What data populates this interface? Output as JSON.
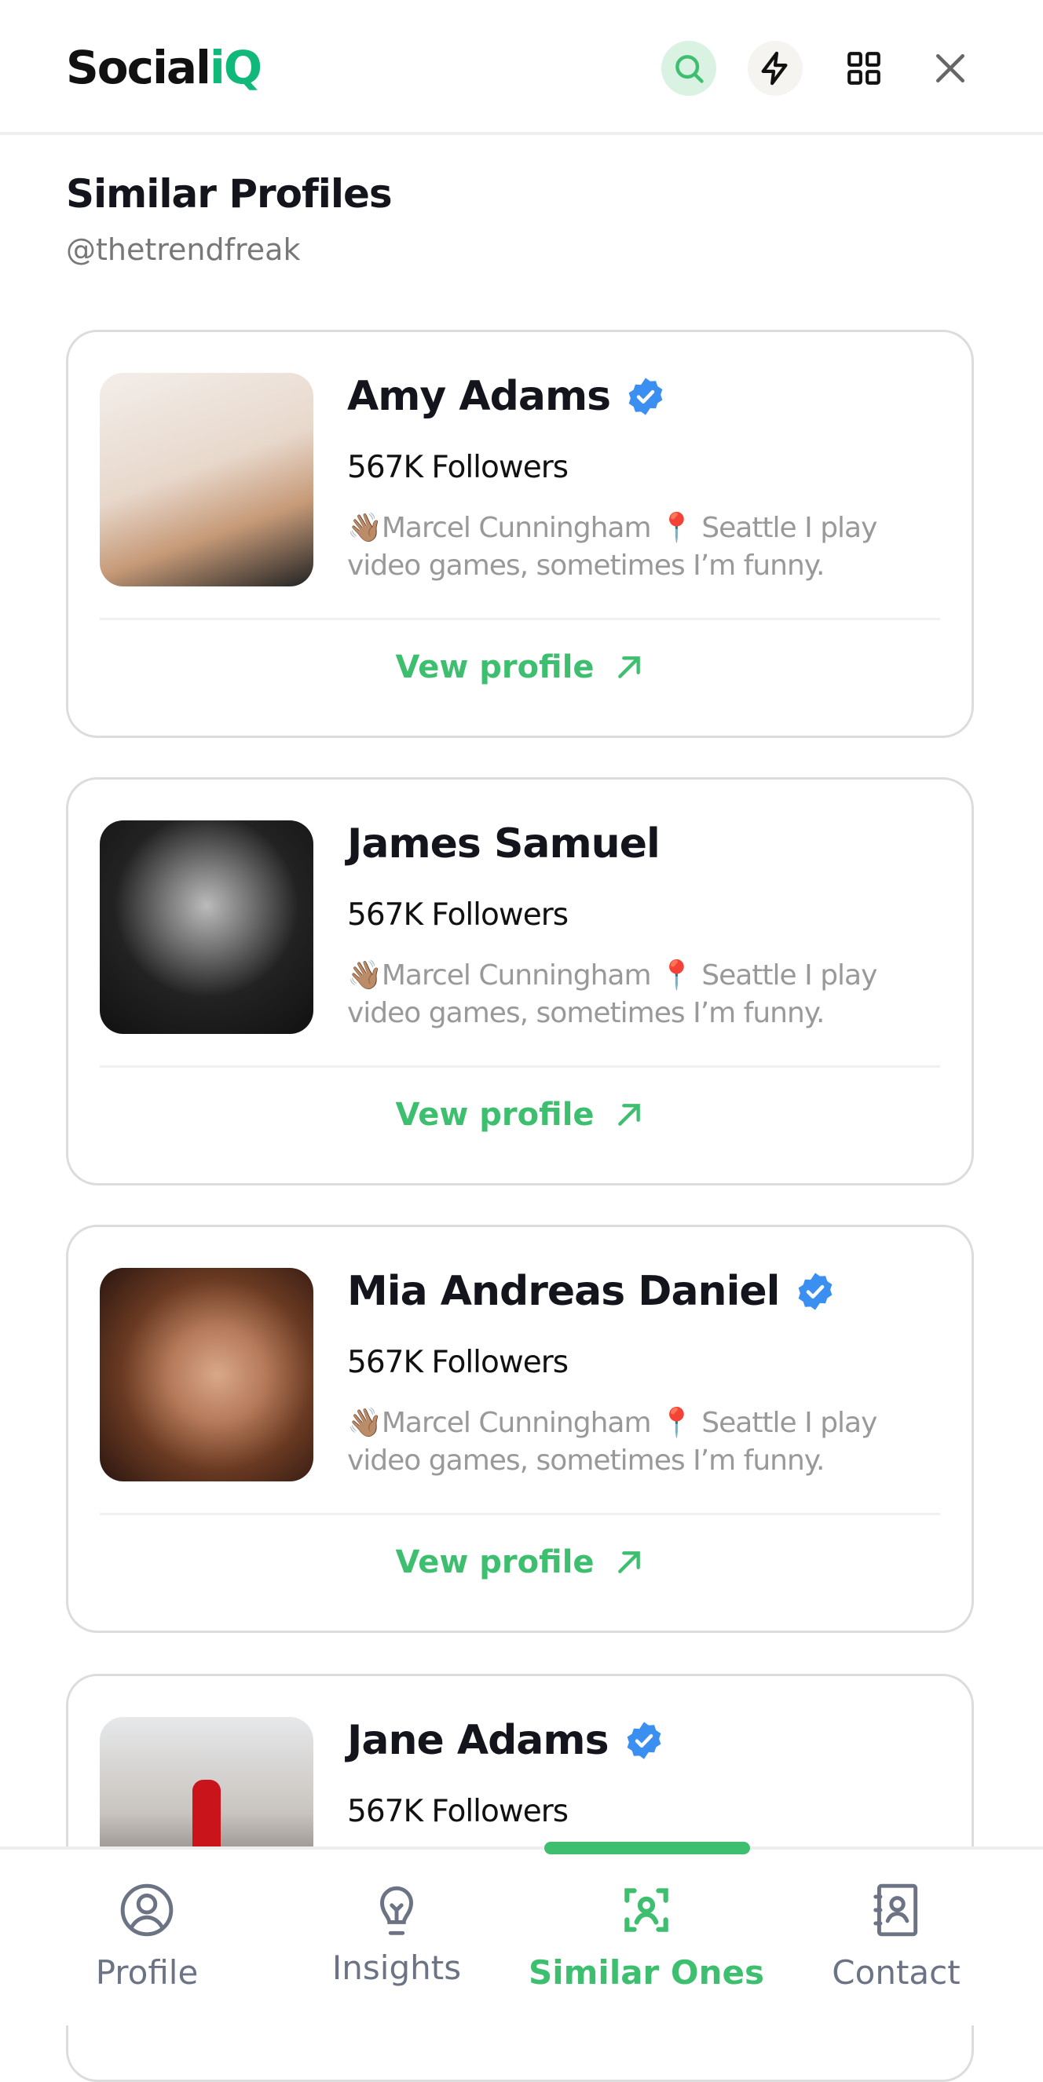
{
  "app": {
    "logo_main": "Social",
    "logo_accent": "iQ",
    "accent_color": "#3dbf6f"
  },
  "header": {
    "icons": [
      "search-icon",
      "bolt-icon",
      "grid-icon",
      "close-icon"
    ]
  },
  "page": {
    "title": "Similar Profiles",
    "handle": "@thetrendfreak"
  },
  "profiles": [
    {
      "name": "Amy Adams",
      "verified": true,
      "followers": "567K  Followers",
      "bio_line1": "👋🏽Marcel Cunningham 📍 Seattle I play",
      "bio_line2": "video games, sometimes I’m funny.",
      "action": "Vew profile"
    },
    {
      "name": "James Samuel",
      "verified": false,
      "followers": "567K  Followers",
      "bio_line1": "👋🏽Marcel Cunningham 📍 Seattle I play",
      "bio_line2": "video games, sometimes I’m funny.",
      "action": "Vew profile"
    },
    {
      "name": "Mia Andreas Daniel",
      "verified": true,
      "followers": "567K  Followers",
      "bio_line1": "👋🏽Marcel Cunningham 📍 Seattle I play",
      "bio_line2": "video games, sometimes I’m funny.",
      "action": "Vew profile"
    },
    {
      "name": "Jane Adams",
      "verified": true,
      "followers": "567K  Followers"
    }
  ],
  "nav": [
    {
      "label": "Profile",
      "icon": "user-circle-icon",
      "active": false
    },
    {
      "label": "Insights",
      "icon": "lightbulb-icon",
      "active": false
    },
    {
      "label": "Similar Ones",
      "icon": "user-scan-icon",
      "active": true
    },
    {
      "label": "Contact",
      "icon": "contact-book-icon",
      "active": false
    }
  ]
}
